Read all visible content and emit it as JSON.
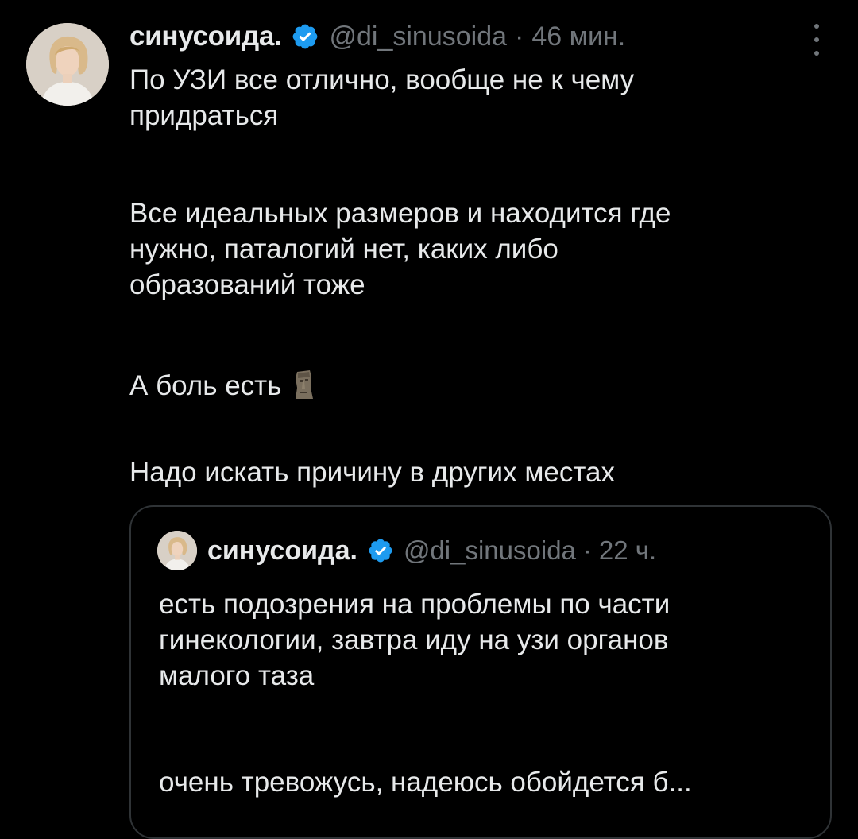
{
  "tweet": {
    "display_name": "синусоида.",
    "handle": "@di_sinusoida",
    "separator": "·",
    "time": "46 мин.",
    "avatar_icon": "user-avatar",
    "more_icon": "more-vertical-icon",
    "verified_icon": "verified-badge-icon",
    "paragraphs": [
      [
        "По УЗИ все отлично, вообще не к чему",
        "придраться"
      ],
      [
        "Все идеальных размеров и находится где",
        "нужно, паталогий нет, каких либо",
        "образований тоже"
      ],
      [
        "А боль есть"
      ],
      [
        "Надо искать причину в других местах"
      ]
    ],
    "emoji": "moai-emoji"
  },
  "quote": {
    "display_name": "синусоида.",
    "handle": "@di_sinusoida",
    "separator": "·",
    "time": "22 ч.",
    "lines": [
      "есть подозрения на проблемы по части",
      "гинекологии, завтра иду на узи органов",
      "малого таза",
      "очень тревожусь, надеюсь обойдется б..."
    ]
  },
  "colors": {
    "background": "#000000",
    "text_primary": "#e7e9ea",
    "text_secondary": "#71767b",
    "verified": "#1d9bf0",
    "border": "#2f3336"
  }
}
